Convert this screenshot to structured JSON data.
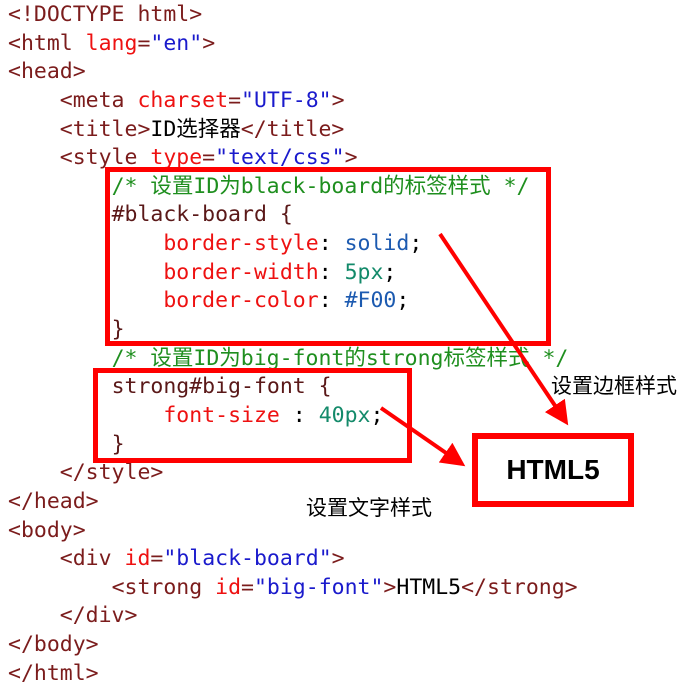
{
  "code_lines": [
    [
      [
        "tag",
        "<!DOCTYPE html>"
      ]
    ],
    [
      [
        "tag",
        "<html "
      ],
      [
        "attr",
        "lang"
      ],
      [
        "tag",
        "="
      ],
      [
        "val",
        "\"en\""
      ],
      [
        "tag",
        ">"
      ]
    ],
    [
      [
        "tag",
        "<head>"
      ]
    ],
    [
      [
        "txt",
        "    "
      ],
      [
        "tag",
        "<meta "
      ],
      [
        "attr",
        "charset"
      ],
      [
        "tag",
        "="
      ],
      [
        "val",
        "\"UTF-8\""
      ],
      [
        "tag",
        ">"
      ]
    ],
    [
      [
        "txt",
        "    "
      ],
      [
        "tag",
        "<title>"
      ],
      [
        "txt",
        "ID选择器"
      ],
      [
        "tag",
        "</title>"
      ]
    ],
    [
      [
        "txt",
        "    "
      ],
      [
        "tag",
        "<style "
      ],
      [
        "attr",
        "type"
      ],
      [
        "tag",
        "="
      ],
      [
        "val",
        "\"text/css\""
      ],
      [
        "tag",
        ">"
      ]
    ],
    [
      [
        "txt",
        "        "
      ],
      [
        "com",
        "/* 设置ID为black-board的标签样式 */"
      ]
    ],
    [
      [
        "txt",
        "        "
      ],
      [
        "sel",
        "#black-board {"
      ]
    ],
    [
      [
        "txt",
        "            "
      ],
      [
        "prop",
        "border-style"
      ],
      [
        "txt",
        ": "
      ],
      [
        "cval",
        "solid"
      ],
      [
        "txt",
        ";"
      ]
    ],
    [
      [
        "txt",
        "            "
      ],
      [
        "prop",
        "border-width"
      ],
      [
        "txt",
        ": "
      ],
      [
        "num",
        "5px"
      ],
      [
        "txt",
        ";"
      ]
    ],
    [
      [
        "txt",
        "            "
      ],
      [
        "prop",
        "border-color"
      ],
      [
        "txt",
        ": "
      ],
      [
        "cval",
        "#F00"
      ],
      [
        "txt",
        ";"
      ]
    ],
    [
      [
        "txt",
        "        "
      ],
      [
        "sel",
        "}"
      ]
    ],
    [
      [
        "txt",
        "        "
      ],
      [
        "com",
        "/* 设置ID为big-font的strong标签样式 */"
      ]
    ],
    [
      [
        "txt",
        "        "
      ],
      [
        "sel",
        "strong#big-font {"
      ]
    ],
    [
      [
        "txt",
        "            "
      ],
      [
        "prop",
        "font-size"
      ],
      [
        "txt",
        " : "
      ],
      [
        "num",
        "40px"
      ],
      [
        "txt",
        ";"
      ]
    ],
    [
      [
        "txt",
        "        "
      ],
      [
        "sel",
        "}"
      ]
    ],
    [
      [
        "txt",
        "    "
      ],
      [
        "tag",
        "</style>"
      ]
    ],
    [
      [
        "tag",
        "</head>"
      ]
    ],
    [
      [
        "tag",
        "<body>"
      ]
    ],
    [
      [
        "txt",
        "    "
      ],
      [
        "tag",
        "<div "
      ],
      [
        "attr",
        "id"
      ],
      [
        "tag",
        "="
      ],
      [
        "val",
        "\"black-board\""
      ],
      [
        "tag",
        ">"
      ]
    ],
    [
      [
        "txt",
        "        "
      ],
      [
        "tag",
        "<strong "
      ],
      [
        "attr",
        "id"
      ],
      [
        "tag",
        "="
      ],
      [
        "val",
        "\"big-font\""
      ],
      [
        "tag",
        ">"
      ],
      [
        "txt",
        "HTML5"
      ],
      [
        "tag",
        "</strong>"
      ]
    ],
    [
      [
        "txt",
        "    "
      ],
      [
        "tag",
        "</div>"
      ]
    ],
    [
      [
        "tag",
        "</body>"
      ]
    ],
    [
      [
        "tag",
        "</html>"
      ]
    ]
  ],
  "annotations": {
    "border_label": "设置边框样式",
    "font_label": "设置文字样式",
    "preview_text": "HTML5",
    "highlight_color": "#FF0000"
  }
}
